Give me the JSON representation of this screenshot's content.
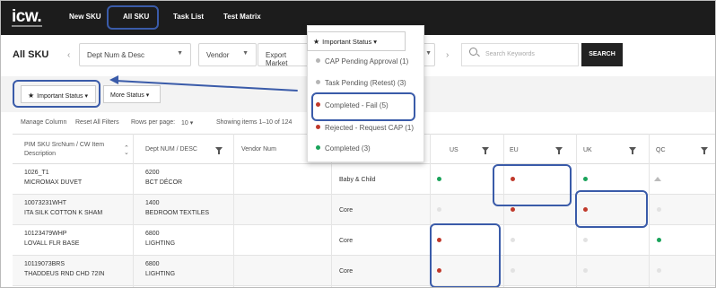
{
  "nav": {
    "logo": "icw.",
    "items": [
      "New SKU",
      "All SKU",
      "Task List",
      "Test Matrix"
    ]
  },
  "header": {
    "title": "All SKU",
    "filters": {
      "dept": "Dept Num & Desc",
      "vendor": "Vendor",
      "export_market": "Export Market"
    },
    "search_placeholder": "Search Keywords",
    "search_button": "SEARCH"
  },
  "status_buttons": {
    "important": "Important Status",
    "more": "More Status"
  },
  "toolbar": {
    "manage_column": "Manage Column",
    "reset_filters": "Reset All Filters",
    "rows_per_page_label": "Rows per page:",
    "rows_per_page_value": "10",
    "showing": "Showing items 1–10 of 124"
  },
  "dropdown": {
    "header": "Important Status",
    "items": [
      {
        "label": "CAP Pending Approval",
        "count": "(1)",
        "color": "#b5b5b5"
      },
      {
        "label": "Task Pending (Retest)",
        "count": "(3)",
        "color": "#b5b5b5"
      },
      {
        "label": "Completed - Fail",
        "count": "(5)",
        "color": "#c0392b"
      },
      {
        "label": "Rejected - Request CAP",
        "count": "(1)",
        "color": "#c0392b"
      },
      {
        "label": "Completed",
        "count": "(3)",
        "color": "#1aa35a"
      }
    ]
  },
  "table": {
    "headers": {
      "sku_line1": "PIM SKU SrcNum / CW Item",
      "sku_line2": "Description",
      "dept": "Dept NUM / DESC",
      "vendor": "Vendor Num",
      "us": "US",
      "eu": "EU",
      "uk": "UK",
      "qc": "QC"
    },
    "rows": [
      {
        "sku": "1026_T1",
        "desc": "MICROMAX DUVET",
        "dept_num": "6200",
        "dept_desc": "BCT DÉCOR",
        "category": "Baby & Child"
      },
      {
        "sku": "10073231WHT",
        "desc": "ITA SILK COTTON K SHAM",
        "dept_num": "1400",
        "dept_desc": "BEDROOM TEXTILES",
        "category": "Core"
      },
      {
        "sku": "10123479WHP",
        "desc": "LOVALL FLR BASE",
        "dept_num": "6800",
        "dept_desc": "LIGHTING",
        "category": "Core"
      },
      {
        "sku": "10119073BRS",
        "desc": "THADDEUS RND CHD 72IN",
        "dept_num": "6800",
        "dept_desc": "LIGHTING",
        "category": "Core"
      }
    ]
  },
  "colors": {
    "green": "#1aa35a",
    "red": "#c0392b",
    "grey": "#dcdcdc",
    "highlight": "#3a5ba9"
  }
}
